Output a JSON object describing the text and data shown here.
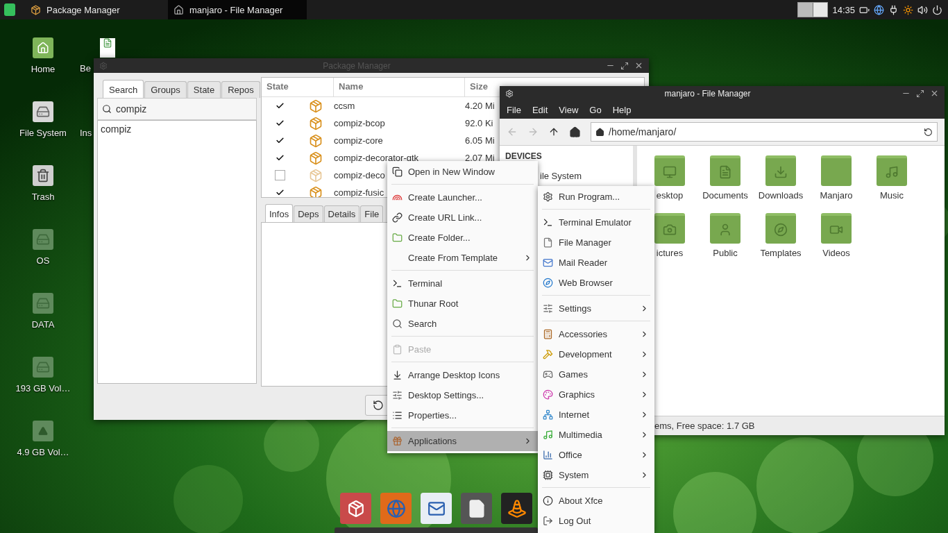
{
  "panel": {
    "tasks": [
      {
        "label": "Package Manager",
        "selected": false
      },
      {
        "label": "manjaro - File Manager",
        "selected": true
      }
    ],
    "clock": "14:35"
  },
  "desktop_icons": [
    {
      "label": "Home",
      "kind": "home"
    },
    {
      "label": "File System",
      "kind": "drive"
    },
    {
      "label": "Trash",
      "kind": "trash"
    },
    {
      "label": "OS",
      "kind": "volume"
    },
    {
      "label": "DATA",
      "kind": "volume"
    },
    {
      "label": "193 GB Vol…",
      "kind": "volume"
    },
    {
      "label": "4.9 GB Vol…",
      "kind": "removable"
    }
  ],
  "desktop_icons_2": [
    {
      "label": "Be",
      "kind": "document"
    },
    {
      "label": "Ins",
      "kind": "hidden"
    }
  ],
  "package_manager": {
    "title": "Package Manager",
    "side_tabs": [
      {
        "label": "Search",
        "selected": true
      },
      {
        "label": "Groups",
        "selected": false
      },
      {
        "label": "State",
        "selected": false
      },
      {
        "label": "Repos",
        "selected": false
      }
    ],
    "search": {
      "value": "compiz"
    },
    "search_results": [
      "compiz"
    ],
    "columns": [
      "State",
      "Name",
      "Size"
    ],
    "rows": [
      {
        "checked": true,
        "name": "ccsm",
        "size": "4.20 Mi"
      },
      {
        "checked": true,
        "name": "compiz-bcop",
        "size": "92.0 Ki"
      },
      {
        "checked": true,
        "name": "compiz-core",
        "size": "6.05 Mi"
      },
      {
        "checked": true,
        "name": "compiz-decorator-gtk",
        "size": "2.07 Mi"
      },
      {
        "checked": false,
        "name": "compiz-deco"
      },
      {
        "checked": true,
        "name": "compiz-fusic"
      }
    ],
    "info_tabs": [
      {
        "label": "Infos",
        "selected": true
      },
      {
        "label": "Deps",
        "selected": false
      },
      {
        "label": "Details",
        "selected": false
      },
      {
        "label": "File",
        "selected": false
      }
    ]
  },
  "file_manager": {
    "title": "manjaro - File Manager",
    "menu": [
      "File",
      "Edit",
      "View",
      "Go",
      "Help"
    ],
    "path": "/home/manjaro/",
    "sidebar_heading": "DEVICES",
    "sidebar_items": [
      "ile System"
    ],
    "items": [
      {
        "label": "esktop",
        "kind": "desktop"
      },
      {
        "label": "Documents",
        "kind": "documents"
      },
      {
        "label": "Downloads",
        "kind": "downloads"
      },
      {
        "label": "Manjaro",
        "kind": "folder"
      },
      {
        "label": "Music",
        "kind": "music"
      },
      {
        "label": "ictures",
        "kind": "pictures"
      },
      {
        "label": "Public",
        "kind": "public"
      },
      {
        "label": "Templates",
        "kind": "templates"
      },
      {
        "label": "Videos",
        "kind": "videos"
      }
    ],
    "status": "ems, Free space: 1.7 GB"
  },
  "desktop_menu": [
    {
      "kind": "item",
      "label": "Open in New Window",
      "submenu": false,
      "disabled": false,
      "selected": false
    },
    {
      "kind": "separator"
    },
    {
      "kind": "item",
      "label": "Create Launcher...",
      "submenu": false,
      "disabled": false,
      "selected": false
    },
    {
      "kind": "item",
      "label": "Create URL Link...",
      "submenu": false,
      "disabled": false,
      "selected": false
    },
    {
      "kind": "item",
      "label": "Create Folder...",
      "submenu": false,
      "disabled": false,
      "selected": false
    },
    {
      "kind": "item",
      "label": "Create From Template",
      "submenu": true,
      "disabled": false,
      "selected": false
    },
    {
      "kind": "separator"
    },
    {
      "kind": "item",
      "label": "Terminal",
      "submenu": false,
      "disabled": false,
      "selected": false
    },
    {
      "kind": "item",
      "label": "Thunar Root",
      "submenu": false,
      "disabled": false,
      "selected": false
    },
    {
      "kind": "item",
      "label": "Search",
      "submenu": false,
      "disabled": false,
      "selected": false
    },
    {
      "kind": "separator"
    },
    {
      "kind": "item",
      "label": "Paste",
      "submenu": false,
      "disabled": true,
      "selected": false
    },
    {
      "kind": "separator"
    },
    {
      "kind": "item",
      "label": "Arrange Desktop Icons",
      "submenu": false,
      "disabled": false,
      "selected": false
    },
    {
      "kind": "item",
      "label": "Desktop Settings...",
      "submenu": false,
      "disabled": false,
      "selected": false
    },
    {
      "kind": "item",
      "label": "Properties...",
      "submenu": false,
      "disabled": false,
      "selected": false
    },
    {
      "kind": "separator"
    },
    {
      "kind": "item",
      "label": "Applications",
      "submenu": true,
      "disabled": false,
      "selected": true
    }
  ],
  "applications_menu": [
    {
      "kind": "item",
      "label": "Run Program...",
      "submenu": false
    },
    {
      "kind": "separator"
    },
    {
      "kind": "item",
      "label": "Terminal Emulator",
      "submenu": false
    },
    {
      "kind": "item",
      "label": "File Manager",
      "submenu": false
    },
    {
      "kind": "item",
      "label": "Mail Reader",
      "submenu": false
    },
    {
      "kind": "item",
      "label": "Web Browser",
      "submenu": false
    },
    {
      "kind": "separator"
    },
    {
      "kind": "item",
      "label": "Settings",
      "submenu": true
    },
    {
      "kind": "separator"
    },
    {
      "kind": "item",
      "label": "Accessories",
      "submenu": true
    },
    {
      "kind": "item",
      "label": "Development",
      "submenu": true
    },
    {
      "kind": "item",
      "label": "Games",
      "submenu": true
    },
    {
      "kind": "item",
      "label": "Graphics",
      "submenu": true
    },
    {
      "kind": "item",
      "label": "Internet",
      "submenu": true
    },
    {
      "kind": "item",
      "label": "Multimedia",
      "submenu": true
    },
    {
      "kind": "item",
      "label": "Office",
      "submenu": true
    },
    {
      "kind": "item",
      "label": "System",
      "submenu": true
    },
    {
      "kind": "separator"
    },
    {
      "kind": "item",
      "label": "About Xfce",
      "submenu": false
    },
    {
      "kind": "item",
      "label": "Log Out",
      "submenu": false
    }
  ]
}
